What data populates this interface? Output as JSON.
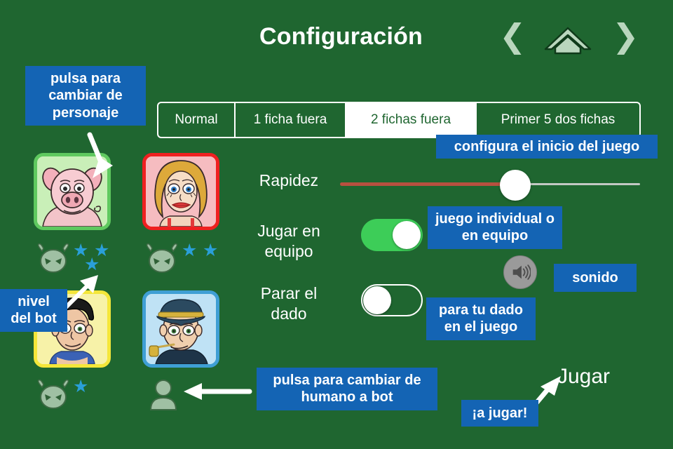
{
  "header": {
    "title": "Configuración",
    "prev_icon": "chevron-left-icon",
    "next_icon": "chevron-right-icon",
    "home_icon": "home-icon",
    "prev_glyph": "❮",
    "next_glyph": "❯"
  },
  "mode_tabs": {
    "selected": "2 fichas fuera",
    "items": [
      {
        "label": "Normal",
        "active": false
      },
      {
        "label": "1 ficha fuera",
        "active": false
      },
      {
        "label": "2 fichas fuera",
        "active": true
      },
      {
        "label": "Primer 5 dos fichas",
        "active": false
      }
    ]
  },
  "players": [
    {
      "name": "pig-avatar",
      "frame_color": "#5fc95f",
      "type": "bot",
      "bot_level": 3
    },
    {
      "name": "woman-avatar",
      "frame_color": "#ef2020",
      "type": "bot",
      "bot_level": 2
    },
    {
      "name": "man-avatar",
      "frame_color": "#f4e63a",
      "type": "bot",
      "bot_level": 1
    },
    {
      "name": "sailor-avatar",
      "frame_color": "#3f9fd4",
      "type": "human",
      "bot_level": 0
    }
  ],
  "settings": {
    "speed": {
      "label": "Rapidez",
      "value_percent": 60,
      "active_color": "#b8503f",
      "inactive_color": "#c3c8c3"
    },
    "team": {
      "label": "Jugar en equipo",
      "on": true,
      "on_color": "#3dcd58"
    },
    "dice": {
      "label": "Parar el dado",
      "on": false
    },
    "sound": {
      "icon": "speaker-icon",
      "enabled": true
    }
  },
  "play_button": {
    "label": "Jugar"
  },
  "callouts": {
    "personaje": "pulsa para cambiar de personaje",
    "inicio": "configura el inicio del juego",
    "equipo": "juego individual o en equipo",
    "sonido": "sonido",
    "dado": "para tu dado en el juego",
    "nivel": "nivel del bot",
    "humano": "pulsa para cambiar de humano a bot",
    "ajugar": "¡a jugar!"
  },
  "colors": {
    "background": "#1f6630",
    "callout_blue": "#1464b4",
    "star_blue": "#2a9fd8",
    "bot_icon": "#9fc0a3"
  }
}
